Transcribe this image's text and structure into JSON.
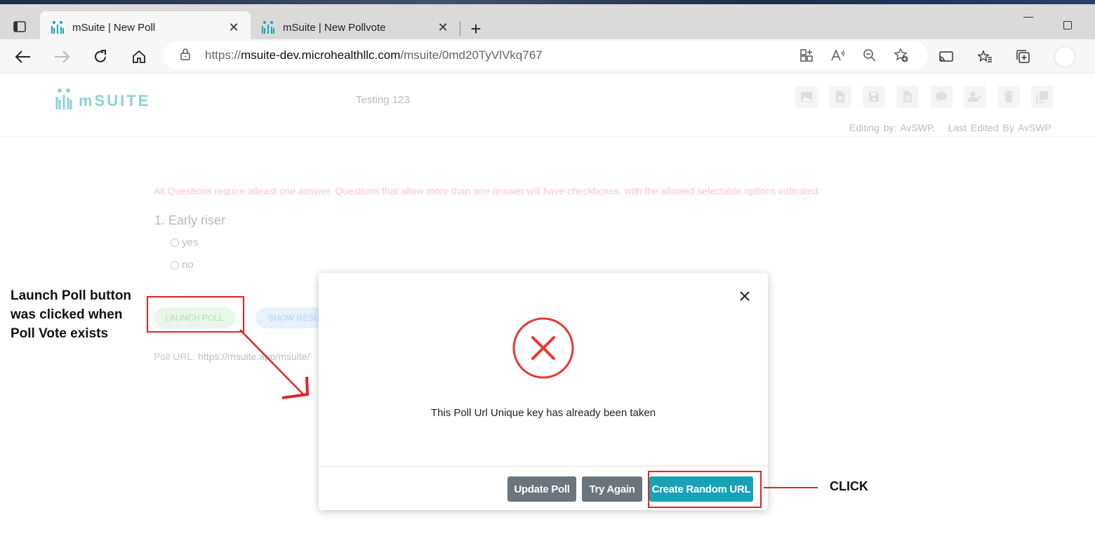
{
  "browser": {
    "tabs": [
      {
        "title": "mSuite | New Poll",
        "active": true
      },
      {
        "title": "mSuite | New Pollvote",
        "active": false
      }
    ],
    "url_scheme": "https://",
    "url_host": "msuite-dev.microhealthllc.com",
    "url_path": "/msuite/0md20TyVlVkq767",
    "new_tab_symbol": "+",
    "close_symbol": "✕"
  },
  "app": {
    "brand": "mSUITE",
    "poll_title": "Testing 123",
    "editing_by": "Editing by: AvSWP,",
    "last_edited": "Last Edited By AvSWP",
    "notice": "All Questions require atleast one answer. Questions that allow more than one answer will have checkboxes, with the allowed selectable options indicated.",
    "question": "1. Early riser",
    "options": [
      "yes",
      "no"
    ],
    "launch_label": "LAUNCH POLL",
    "show_results_label": "SHOW RESULTS",
    "poll_url_label": "Poll URL:",
    "poll_url_value": "https://msuite.app/msuite/",
    "toolbar_icons": [
      "image-icon",
      "excel-icon",
      "save-icon",
      "copy-icon",
      "comment-icon",
      "user-edit-icon",
      "delete-icon",
      "duplicate-icon"
    ]
  },
  "modal": {
    "message": "This Poll Url Unique key has already been taken",
    "buttons": {
      "update": "Update Poll",
      "try_again": "Try Again",
      "random": "Create Random URL"
    },
    "icon": "error-x-icon",
    "accent": "#e53935"
  },
  "annotations": {
    "left_note": "Launch Poll button was clicked when Poll Vote exists",
    "right_note": "CLICK",
    "color": "#e0242a"
  }
}
